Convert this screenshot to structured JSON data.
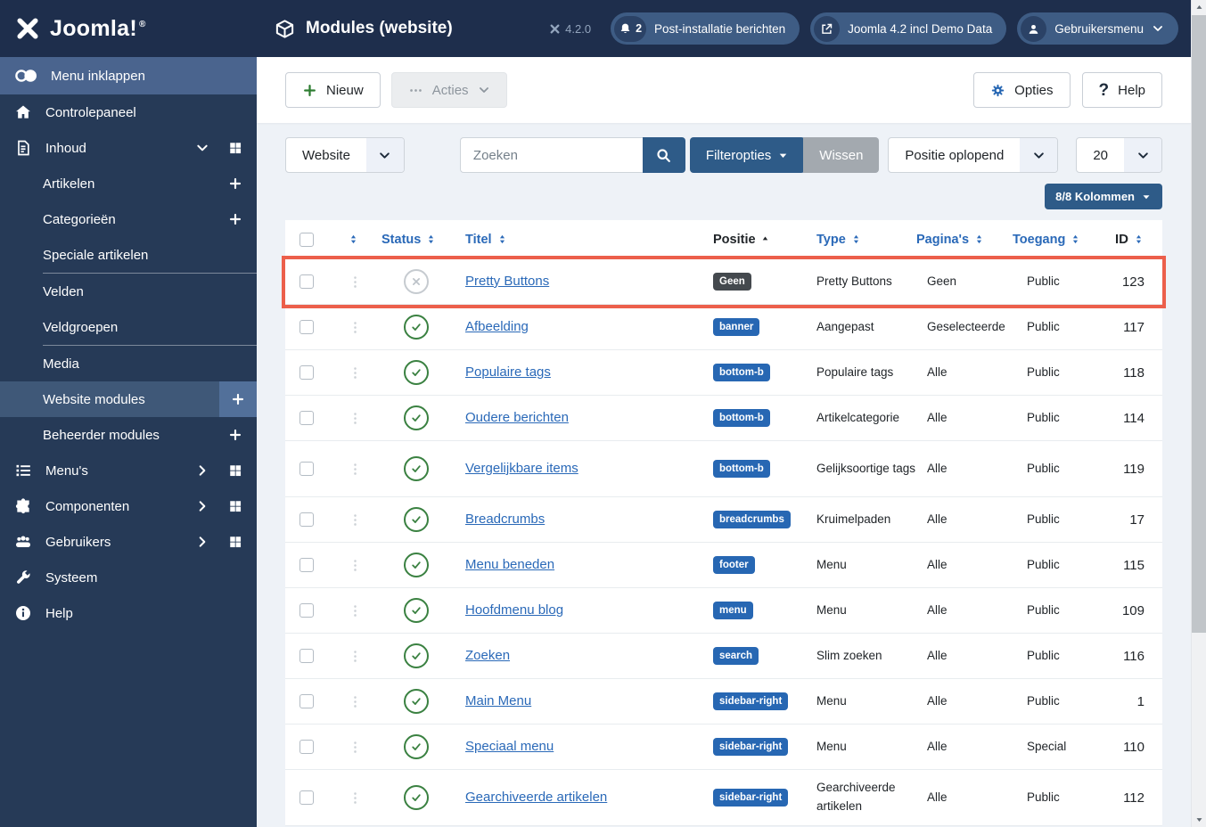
{
  "brand": {
    "name": "Joomla!",
    "reg": "®"
  },
  "sidebar": {
    "items": [
      {
        "label": "Menu inklappen",
        "icon": "toggle",
        "band": true
      },
      {
        "label": "Controlepaneel",
        "icon": "home"
      },
      {
        "label": "Inhoud",
        "icon": "file",
        "right": [
          "chevron-down",
          "grid"
        ]
      },
      {
        "label": "Artikelen",
        "indent": true,
        "plus": true
      },
      {
        "label": "Categorieën",
        "indent": true,
        "plus": true
      },
      {
        "label": "Speciale artikelen",
        "indent": true,
        "divider": true
      },
      {
        "label": "Velden",
        "indent": true
      },
      {
        "label": "Veldgroepen",
        "indent": true,
        "divider": true
      },
      {
        "label": "Media",
        "indent": true
      },
      {
        "label": "Website modules",
        "indent": true,
        "active": true,
        "plus": true
      },
      {
        "label": "Beheerder modules",
        "indent": true,
        "plus": true
      },
      {
        "label": "Menu's",
        "icon": "list",
        "right": [
          "chevron-right",
          "grid"
        ]
      },
      {
        "label": "Componenten",
        "icon": "puzzle",
        "right": [
          "chevron-right",
          "grid"
        ]
      },
      {
        "label": "Gebruikers",
        "icon": "users",
        "right": [
          "chevron-right",
          "grid"
        ]
      },
      {
        "label": "Systeem",
        "icon": "wrench"
      },
      {
        "label": "Help",
        "icon": "info"
      }
    ]
  },
  "header": {
    "title": "Modules (website)",
    "version": "4.2.0",
    "pills": [
      {
        "label": "Post-installatie berichten",
        "icon": "bell",
        "badge": "2"
      },
      {
        "label": "Joomla 4.2 incl Demo Data",
        "icon": "external-link"
      },
      {
        "label": "Gebruikersmenu",
        "icon": "user",
        "caret": true
      }
    ]
  },
  "toolbar": {
    "new_label": "Nieuw",
    "actions_label": "Acties",
    "options_label": "Opties",
    "help_label": "Help"
  },
  "filters": {
    "client_selected": "Website",
    "search_placeholder": "Zoeken",
    "filter_options_label": "Filteropties",
    "clear_label": "Wissen",
    "sort_selected": "Positie oplopend",
    "limit_selected": "20",
    "columns_label": "8/8 Kolommen"
  },
  "table": {
    "headers": {
      "status": "Status",
      "title": "Titel",
      "position": "Positie",
      "type": "Type",
      "pages": "Pagina's",
      "access": "Toegang",
      "id": "ID"
    },
    "sorted_by": "Positie",
    "sorted_dir": "asc",
    "rows": [
      {
        "title": "Pretty Buttons",
        "status": "unpublished",
        "position": "Geen",
        "position_dark": true,
        "type": "Pretty Buttons",
        "pages": "Geen",
        "access": "Public",
        "id": "123",
        "highlighted": true
      },
      {
        "title": "Afbeelding",
        "status": "published",
        "position": "banner",
        "type": "Aangepast",
        "pages": "Geselecteerde",
        "access": "Public",
        "id": "117"
      },
      {
        "title": "Populaire tags",
        "status": "published",
        "position": "bottom-b",
        "type": "Populaire tags",
        "pages": "Alle",
        "access": "Public",
        "id": "118"
      },
      {
        "title": "Oudere berichten",
        "status": "published",
        "position": "bottom-b",
        "type": "Artikelcategorie",
        "pages": "Alle",
        "access": "Public",
        "id": "114"
      },
      {
        "title": "Vergelijkbare items",
        "status": "published",
        "position": "bottom-b",
        "type": "Gelijksoortige tags",
        "pages": "Alle",
        "access": "Public",
        "id": "119",
        "tall": true
      },
      {
        "title": "Breadcrumbs",
        "status": "published",
        "position": "breadcrumbs",
        "type": "Kruimelpaden",
        "pages": "Alle",
        "access": "Public",
        "id": "17"
      },
      {
        "title": "Menu beneden",
        "status": "published",
        "position": "footer",
        "type": "Menu",
        "pages": "Alle",
        "access": "Public",
        "id": "115"
      },
      {
        "title": "Hoofdmenu blog",
        "status": "published",
        "position": "menu",
        "type": "Menu",
        "pages": "Alle",
        "access": "Public",
        "id": "109"
      },
      {
        "title": "Zoeken",
        "status": "published",
        "position": "search",
        "type": "Slim zoeken",
        "pages": "Alle",
        "access": "Public",
        "id": "116"
      },
      {
        "title": "Main Menu",
        "status": "published",
        "position": "sidebar-right",
        "type": "Menu",
        "pages": "Alle",
        "access": "Public",
        "id": "1"
      },
      {
        "title": "Speciaal menu",
        "status": "published",
        "position": "sidebar-right",
        "type": "Menu",
        "pages": "Alle",
        "access": "Special",
        "id": "110"
      },
      {
        "title": "Gearchiveerde artikelen",
        "status": "published",
        "position": "sidebar-right",
        "type": "Gearchiveerde artikelen",
        "pages": "Alle",
        "access": "Public",
        "id": "112",
        "tall": true
      }
    ]
  },
  "colors": {
    "topbar_bg": "#1e2e4c",
    "sidebar_bg": "#263a57",
    "sidebar_active_bg": "#3f5878",
    "primary_button_blue": "#2e5b88",
    "badge_blue": "#2767b3",
    "badge_dark": "#44494e",
    "link_blue": "#2a69b8",
    "success_green": "#3a8141",
    "highlight_red": "#ec5f4b"
  }
}
